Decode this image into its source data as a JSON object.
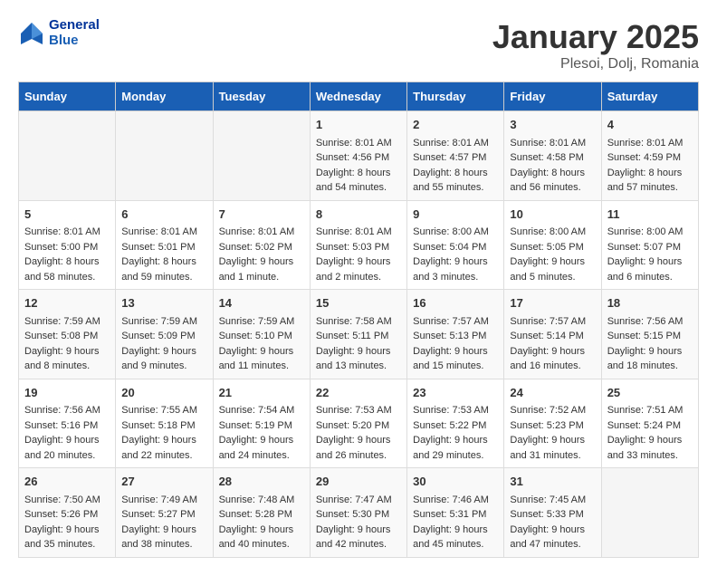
{
  "header": {
    "logo_line1": "General",
    "logo_line2": "Blue",
    "month": "January 2025",
    "location": "Plesoi, Dolj, Romania"
  },
  "weekdays": [
    "Sunday",
    "Monday",
    "Tuesday",
    "Wednesday",
    "Thursday",
    "Friday",
    "Saturday"
  ],
  "weeks": [
    [
      {
        "day": "",
        "info": ""
      },
      {
        "day": "",
        "info": ""
      },
      {
        "day": "",
        "info": ""
      },
      {
        "day": "1",
        "info": "Sunrise: 8:01 AM\nSunset: 4:56 PM\nDaylight: 8 hours\nand 54 minutes."
      },
      {
        "day": "2",
        "info": "Sunrise: 8:01 AM\nSunset: 4:57 PM\nDaylight: 8 hours\nand 55 minutes."
      },
      {
        "day": "3",
        "info": "Sunrise: 8:01 AM\nSunset: 4:58 PM\nDaylight: 8 hours\nand 56 minutes."
      },
      {
        "day": "4",
        "info": "Sunrise: 8:01 AM\nSunset: 4:59 PM\nDaylight: 8 hours\nand 57 minutes."
      }
    ],
    [
      {
        "day": "5",
        "info": "Sunrise: 8:01 AM\nSunset: 5:00 PM\nDaylight: 8 hours\nand 58 minutes."
      },
      {
        "day": "6",
        "info": "Sunrise: 8:01 AM\nSunset: 5:01 PM\nDaylight: 8 hours\nand 59 minutes."
      },
      {
        "day": "7",
        "info": "Sunrise: 8:01 AM\nSunset: 5:02 PM\nDaylight: 9 hours\nand 1 minute."
      },
      {
        "day": "8",
        "info": "Sunrise: 8:01 AM\nSunset: 5:03 PM\nDaylight: 9 hours\nand 2 minutes."
      },
      {
        "day": "9",
        "info": "Sunrise: 8:00 AM\nSunset: 5:04 PM\nDaylight: 9 hours\nand 3 minutes."
      },
      {
        "day": "10",
        "info": "Sunrise: 8:00 AM\nSunset: 5:05 PM\nDaylight: 9 hours\nand 5 minutes."
      },
      {
        "day": "11",
        "info": "Sunrise: 8:00 AM\nSunset: 5:07 PM\nDaylight: 9 hours\nand 6 minutes."
      }
    ],
    [
      {
        "day": "12",
        "info": "Sunrise: 7:59 AM\nSunset: 5:08 PM\nDaylight: 9 hours\nand 8 minutes."
      },
      {
        "day": "13",
        "info": "Sunrise: 7:59 AM\nSunset: 5:09 PM\nDaylight: 9 hours\nand 9 minutes."
      },
      {
        "day": "14",
        "info": "Sunrise: 7:59 AM\nSunset: 5:10 PM\nDaylight: 9 hours\nand 11 minutes."
      },
      {
        "day": "15",
        "info": "Sunrise: 7:58 AM\nSunset: 5:11 PM\nDaylight: 9 hours\nand 13 minutes."
      },
      {
        "day": "16",
        "info": "Sunrise: 7:57 AM\nSunset: 5:13 PM\nDaylight: 9 hours\nand 15 minutes."
      },
      {
        "day": "17",
        "info": "Sunrise: 7:57 AM\nSunset: 5:14 PM\nDaylight: 9 hours\nand 16 minutes."
      },
      {
        "day": "18",
        "info": "Sunrise: 7:56 AM\nSunset: 5:15 PM\nDaylight: 9 hours\nand 18 minutes."
      }
    ],
    [
      {
        "day": "19",
        "info": "Sunrise: 7:56 AM\nSunset: 5:16 PM\nDaylight: 9 hours\nand 20 minutes."
      },
      {
        "day": "20",
        "info": "Sunrise: 7:55 AM\nSunset: 5:18 PM\nDaylight: 9 hours\nand 22 minutes."
      },
      {
        "day": "21",
        "info": "Sunrise: 7:54 AM\nSunset: 5:19 PM\nDaylight: 9 hours\nand 24 minutes."
      },
      {
        "day": "22",
        "info": "Sunrise: 7:53 AM\nSunset: 5:20 PM\nDaylight: 9 hours\nand 26 minutes."
      },
      {
        "day": "23",
        "info": "Sunrise: 7:53 AM\nSunset: 5:22 PM\nDaylight: 9 hours\nand 29 minutes."
      },
      {
        "day": "24",
        "info": "Sunrise: 7:52 AM\nSunset: 5:23 PM\nDaylight: 9 hours\nand 31 minutes."
      },
      {
        "day": "25",
        "info": "Sunrise: 7:51 AM\nSunset: 5:24 PM\nDaylight: 9 hours\nand 33 minutes."
      }
    ],
    [
      {
        "day": "26",
        "info": "Sunrise: 7:50 AM\nSunset: 5:26 PM\nDaylight: 9 hours\nand 35 minutes."
      },
      {
        "day": "27",
        "info": "Sunrise: 7:49 AM\nSunset: 5:27 PM\nDaylight: 9 hours\nand 38 minutes."
      },
      {
        "day": "28",
        "info": "Sunrise: 7:48 AM\nSunset: 5:28 PM\nDaylight: 9 hours\nand 40 minutes."
      },
      {
        "day": "29",
        "info": "Sunrise: 7:47 AM\nSunset: 5:30 PM\nDaylight: 9 hours\nand 42 minutes."
      },
      {
        "day": "30",
        "info": "Sunrise: 7:46 AM\nSunset: 5:31 PM\nDaylight: 9 hours\nand 45 minutes."
      },
      {
        "day": "31",
        "info": "Sunrise: 7:45 AM\nSunset: 5:33 PM\nDaylight: 9 hours\nand 47 minutes."
      },
      {
        "day": "",
        "info": ""
      }
    ]
  ]
}
